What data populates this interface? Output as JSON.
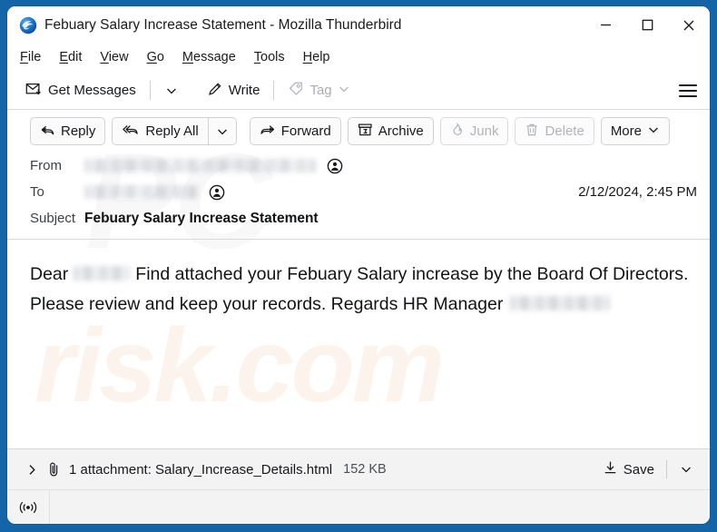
{
  "window": {
    "title": "Febuary Salary Increase Statement - Mozilla Thunderbird",
    "app_icon": "thunderbird-icon",
    "controls": {
      "minimize": "minimize-icon",
      "maximize": "maximize-icon",
      "close": "close-icon"
    },
    "accent_blue": "#1465a7",
    "chrome_bg": "#ffffff"
  },
  "menubar": {
    "items": [
      {
        "label": "File",
        "accel": "F"
      },
      {
        "label": "Edit",
        "accel": "E"
      },
      {
        "label": "View",
        "accel": "V"
      },
      {
        "label": "Go",
        "accel": "G"
      },
      {
        "label": "Message",
        "accel": "M"
      },
      {
        "label": "Tools",
        "accel": "T"
      },
      {
        "label": "Help",
        "accel": "H"
      }
    ]
  },
  "toolbar": {
    "get_messages_label": "Get Messages",
    "get_messages_icon": "envelope-download-icon",
    "get_messages_chevron": "chevron-down-icon",
    "write_label": "Write",
    "write_icon": "pencil-icon",
    "tag_label": "Tag",
    "tag_icon": "tag-icon",
    "tag_chevron": "chevron-down-icon",
    "tag_disabled": true,
    "app_menu_icon": "hamburger-menu-icon"
  },
  "message_actions": [
    {
      "label": "Reply",
      "icon": "reply-arrow-icon",
      "disabled": false
    },
    {
      "label": "Reply All",
      "icon": "reply-all-arrow-icon",
      "disabled": false
    },
    {
      "label": "Forward",
      "icon": "forward-arrow-icon",
      "disabled": false
    },
    {
      "label": "Archive",
      "icon": "archive-box-icon",
      "disabled": false
    },
    {
      "label": "Junk",
      "icon": "junk-flame-icon",
      "disabled": true
    },
    {
      "label": "Delete",
      "icon": "trash-icon",
      "disabled": true
    },
    {
      "label": "More",
      "icon": "chevron-down-icon",
      "disabled": false
    }
  ],
  "headers": {
    "from_label": "From",
    "from_value": "",
    "from_redacted": true,
    "from_contact_icon": "contact-avatar-icon",
    "to_label": "To",
    "to_value": "",
    "to_redacted": true,
    "to_contact_icon": "contact-avatar-icon",
    "date": "2/12/2024, 2:45 PM",
    "subject_label": "Subject",
    "subject_value": "Febuary Salary Increase Statement"
  },
  "body": {
    "greeting": "Dear",
    "redacted_name": "",
    "paragraph": "Find attached your Febuary Salary increase by the Board Of Directors. Please review and keep your records. Regards HR Manager",
    "redacted_signature": ""
  },
  "attachment_bar": {
    "expand_icon": "chevron-right-icon",
    "paperclip_icon": "paperclip-icon",
    "summary": "1 attachment: Salary_Increase_Details.html",
    "count": 1,
    "filename": "Salary_Increase_Details.html",
    "size": "152 KB",
    "save_label": "Save",
    "save_icon": "download-icon",
    "save_chevron": "chevron-down-icon"
  },
  "statusbar": {
    "connection_icon": "broadcast-connection-icon",
    "text": ""
  },
  "watermark": {
    "part1": "PC",
    "part2": "risk.com"
  }
}
